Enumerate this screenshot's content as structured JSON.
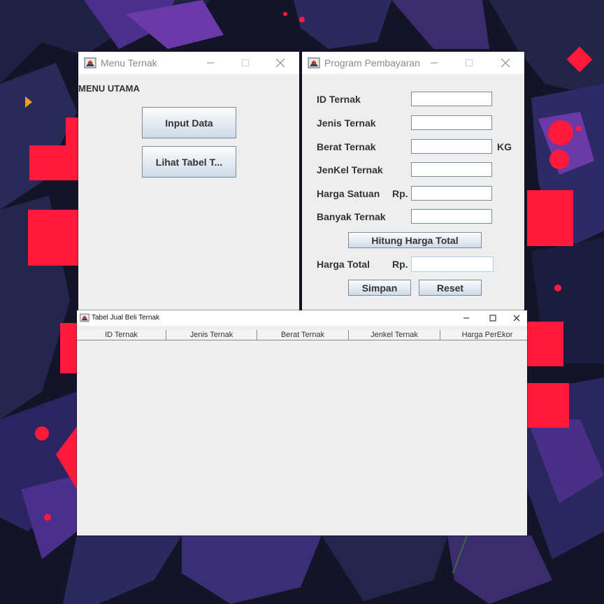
{
  "menu_window": {
    "title": "Menu Ternak",
    "heading": "MENU UTAMA",
    "input_button": "Input Data",
    "view_button": "Lihat Tabel T..."
  },
  "payment_window": {
    "title": "Program Pembayaran",
    "fields": {
      "id": {
        "label": "ID Ternak",
        "value": ""
      },
      "jenis": {
        "label": "Jenis Ternak",
        "value": ""
      },
      "berat": {
        "label": "Berat Ternak",
        "value": "",
        "unit": "KG"
      },
      "jenkel": {
        "label": "JenKel Ternak",
        "value": ""
      },
      "harga_satuan": {
        "label": "Harga Satuan",
        "prefix": "Rp.",
        "value": ""
      },
      "banyak": {
        "label": "Banyak Ternak",
        "value": ""
      },
      "harga_total": {
        "label": "Harga Total",
        "prefix": "Rp.",
        "value": ""
      }
    },
    "hitung_button": "Hitung Harga Total",
    "simpan_button": "Simpan",
    "reset_button": "Reset"
  },
  "table_window": {
    "title": "Tabel Jual Beli Ternak",
    "columns": [
      "ID Ternak",
      "Jenis Ternak",
      "Berat Ternak",
      "Jenkel Ternak",
      "Harga PerEkor"
    ],
    "rows": []
  },
  "icons": {
    "app": "java-cup-icon",
    "minimize": "minimize-icon",
    "maximize": "maximize-icon",
    "close": "close-icon"
  },
  "colors": {
    "accent_red": "#ff1a3c",
    "wallpaper_dark": "#141428",
    "wallpaper_purple": "#3d2f7a"
  }
}
